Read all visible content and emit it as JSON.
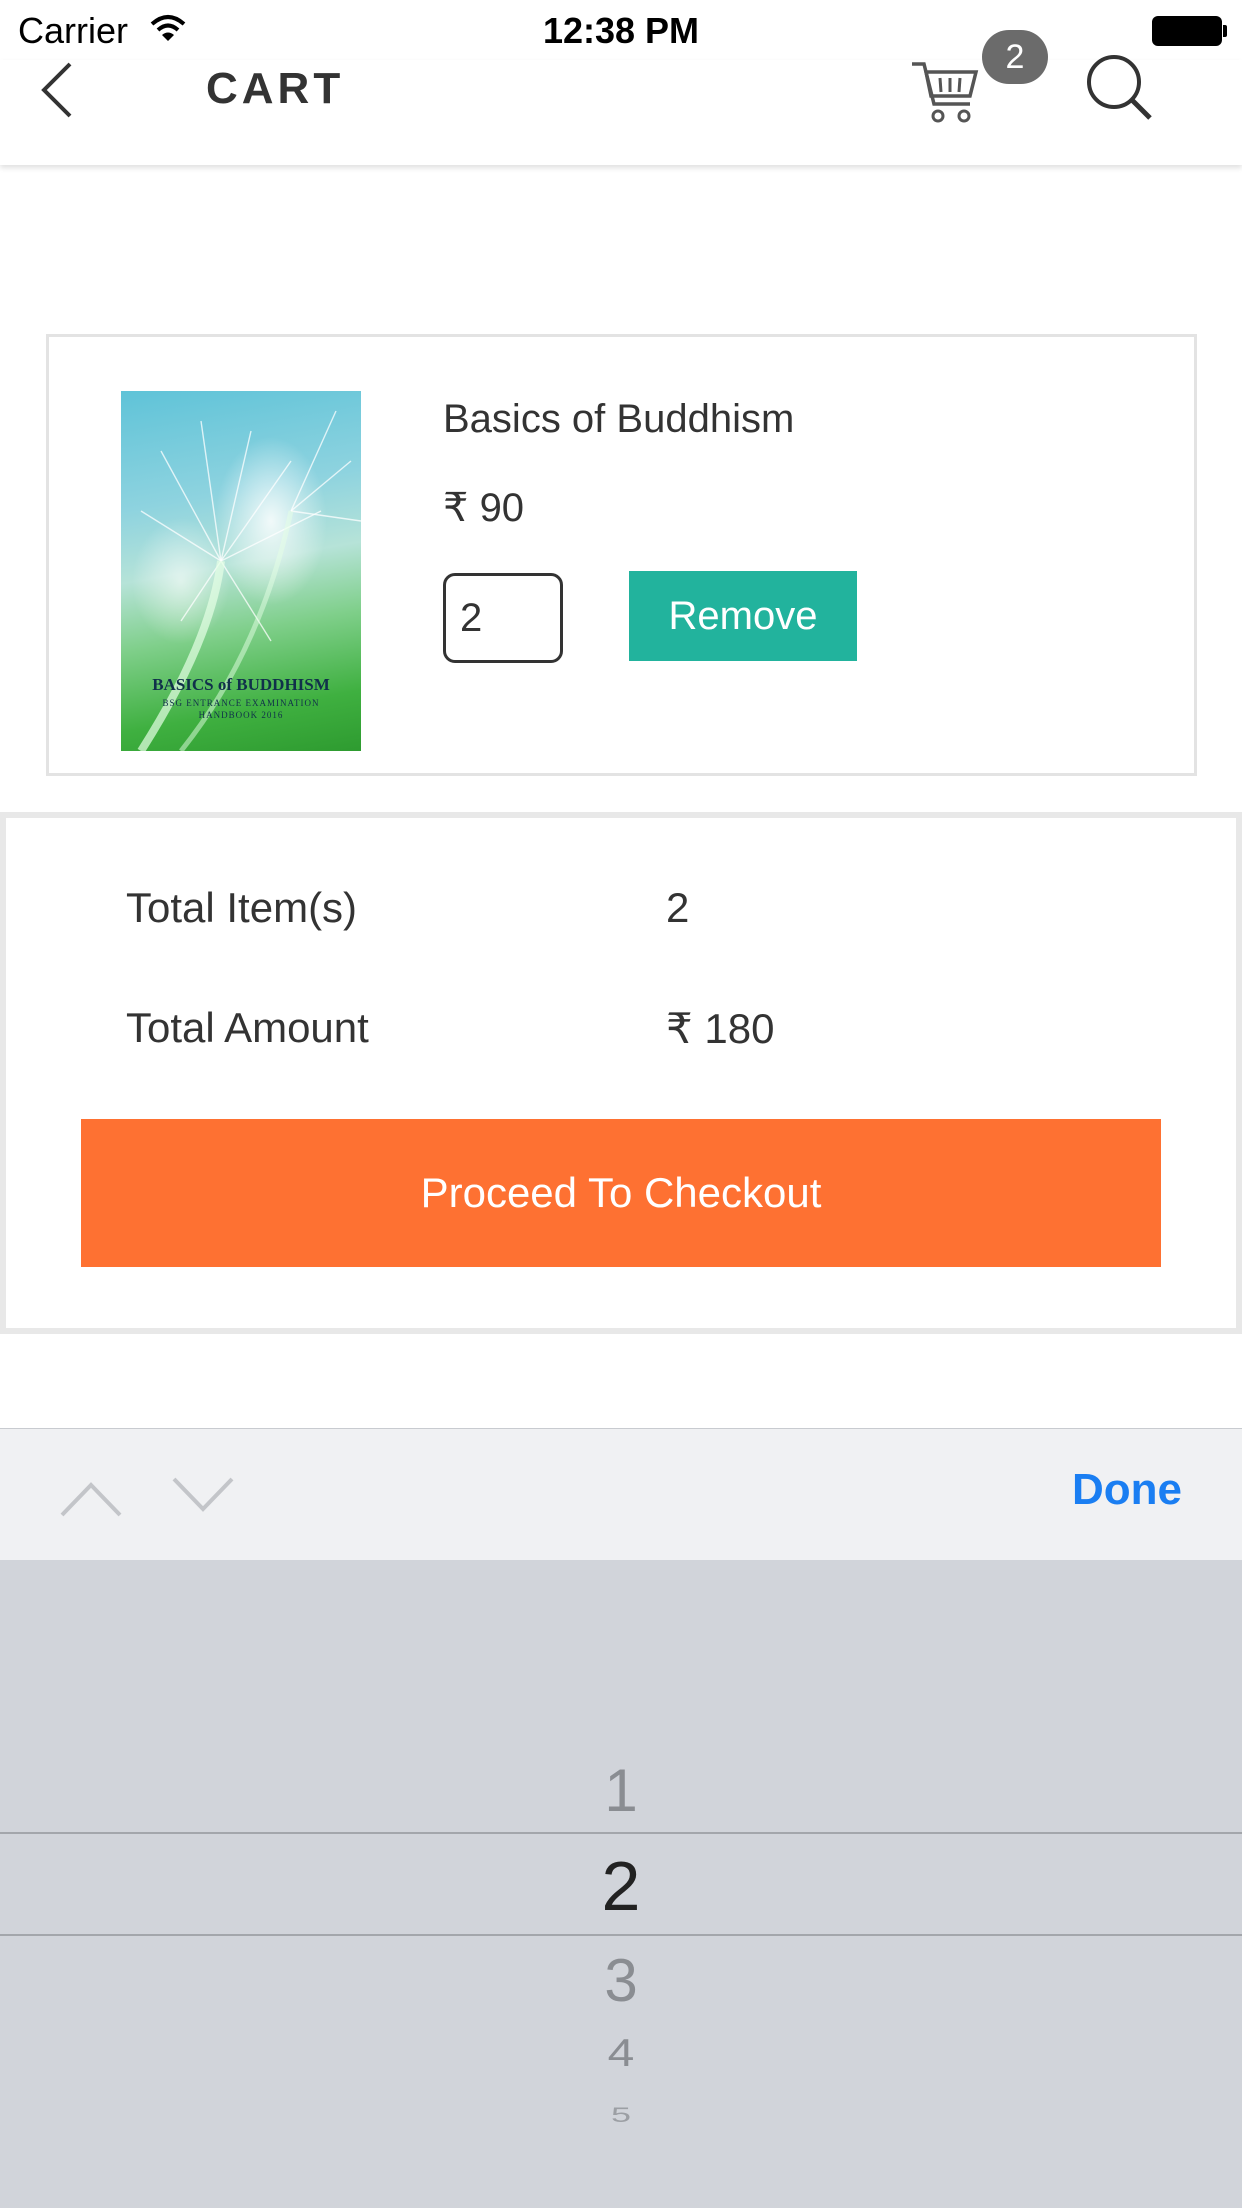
{
  "status_bar": {
    "carrier": "Carrier",
    "time": "12:38 PM"
  },
  "nav": {
    "title": "CART",
    "cart_count": "2",
    "icons": [
      "back-icon",
      "cart-icon",
      "search-icon"
    ]
  },
  "product": {
    "name": "Basics of Buddhism",
    "price": "₹ 90",
    "quantity": "2",
    "remove_label": "Remove",
    "cover_title": "BASICS of BUDDHISM",
    "cover_subtitle": "BSG ENTRANCE EXAMINATION HANDBOOK 2016"
  },
  "totals": {
    "items_label": "Total Item(s)",
    "items_value": "2",
    "amount_label": "Total Amount",
    "amount_value": "₹ 180",
    "checkout_label": "Proceed To Checkout"
  },
  "toolbar": {
    "done_label": "Done",
    "icons": [
      "chevron-up-icon",
      "chevron-down-icon"
    ]
  },
  "picker": {
    "options": [
      "1",
      "2",
      "3",
      "4",
      "5"
    ],
    "selected": "2"
  },
  "colors": {
    "accent_teal": "#22b39d",
    "checkout_orange": "#fe7132",
    "done_blue": "#1a7ef2",
    "badge_gray": "#6b6b6b"
  }
}
